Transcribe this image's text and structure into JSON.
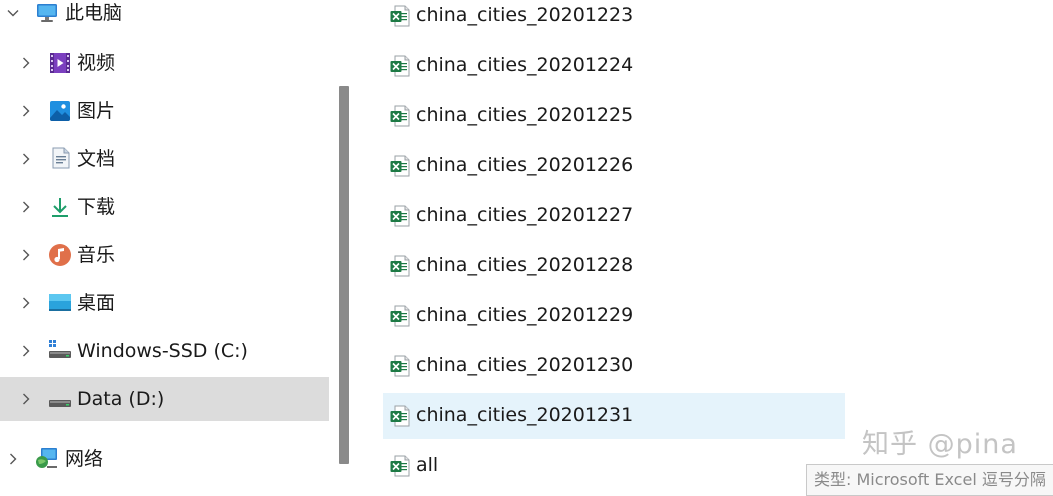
{
  "nav": {
    "items": [
      {
        "label": "此电脑",
        "icon": "this-pc-icon"
      },
      {
        "label": "视频",
        "icon": "videos-icon"
      },
      {
        "label": "图片",
        "icon": "pictures-icon"
      },
      {
        "label": "文档",
        "icon": "documents-icon"
      },
      {
        "label": "下载",
        "icon": "downloads-icon"
      },
      {
        "label": "音乐",
        "icon": "music-icon"
      },
      {
        "label": "桌面",
        "icon": "desktop-icon"
      },
      {
        "label": "Windows-SSD (C:)",
        "icon": "drive-c-icon"
      },
      {
        "label": "Data (D:)",
        "icon": "drive-d-icon",
        "selected": true
      },
      {
        "label": "网络",
        "icon": "network-icon"
      }
    ]
  },
  "files": {
    "items": [
      {
        "name": "china_cities_20201223",
        "icon": "excel-file-icon"
      },
      {
        "name": "china_cities_20201224",
        "icon": "excel-file-icon"
      },
      {
        "name": "china_cities_20201225",
        "icon": "excel-file-icon"
      },
      {
        "name": "china_cities_20201226",
        "icon": "excel-file-icon"
      },
      {
        "name": "china_cities_20201227",
        "icon": "excel-file-icon"
      },
      {
        "name": "china_cities_20201228",
        "icon": "excel-file-icon"
      },
      {
        "name": "china_cities_20201229",
        "icon": "excel-file-icon"
      },
      {
        "name": "china_cities_20201230",
        "icon": "excel-file-icon"
      },
      {
        "name": "china_cities_20201231",
        "icon": "excel-file-icon",
        "selected": true
      },
      {
        "name": "all",
        "icon": "excel-file-icon"
      }
    ]
  },
  "tooltip": {
    "text": "类型: Microsoft Excel 逗号分隔"
  },
  "watermark": {
    "text": "知乎 @pina"
  },
  "colors": {
    "selected_row": "#e5f3fb",
    "nav_selected": "#dcdcdc",
    "excel_green": "#1d7a45"
  }
}
